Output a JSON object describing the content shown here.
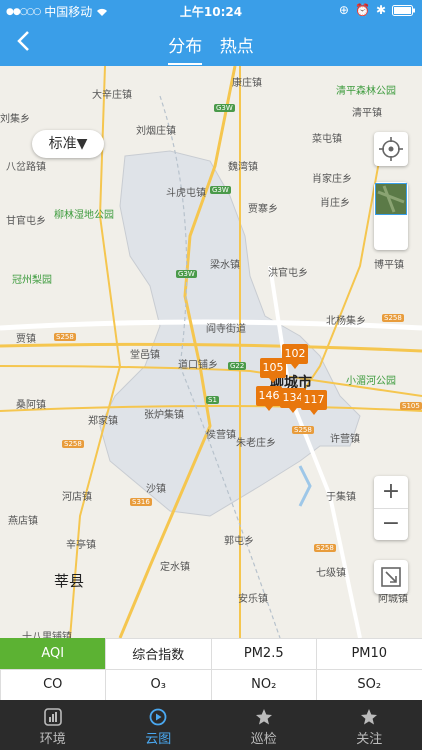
{
  "status_bar": {
    "carrier": "中国移动",
    "time": "上午10:24"
  },
  "header": {
    "tabs": [
      {
        "label": "分布",
        "active": true
      },
      {
        "label": "热点",
        "active": false
      }
    ]
  },
  "map": {
    "style_button_label": "标准▼",
    "places": [
      "大辛庄镇",
      "康庄镇",
      "清平森林公园",
      "刘集乡",
      "刘烟庄镇",
      "清平镇",
      "八岔路镇",
      "菜屯镇",
      "魏湾镇",
      "肖家庄乡",
      "斗虎屯镇",
      "贾寨乡",
      "肖庄乡",
      "甘官屯乡",
      "柳林湿地公园",
      "冠州梨园",
      "梁水镇",
      "洪官屯乡",
      "博平镇",
      "贾镇",
      "北杨集乡",
      "阎寺街道",
      "堂邑镇",
      "道口铺乡",
      "聊城市",
      "小湄河公园",
      "桑阿镇",
      "郑家镇",
      "张炉集镇",
      "侯营镇",
      "许营镇",
      "朱老庄乡",
      "河店镇",
      "沙镇",
      "于集镇",
      "燕店镇",
      "辛亭镇",
      "莘县",
      "郭屯乡",
      "定水镇",
      "七级镇",
      "安乐镇",
      "阿城镇",
      "十八里铺镇"
    ],
    "road_shields": [
      "G3W",
      "G3W",
      "G3W",
      "S258",
      "S258",
      "G22",
      "S1",
      "S258",
      "S105",
      "S316",
      "S258",
      "S258"
    ],
    "aqi_markers": [
      102,
      105,
      146,
      134,
      117
    ]
  },
  "metrics": {
    "row1": [
      "AQI",
      "综合指数",
      "PM2.5",
      "PM10"
    ],
    "row2": [
      "CO",
      "O₃",
      "NO₂",
      "SO₂"
    ],
    "active": "AQI"
  },
  "bottom_nav": [
    "环境",
    "云图",
    "巡检",
    "关注"
  ],
  "colors": {
    "brand": "#3a9ee8",
    "active_metric": "#5cb233",
    "marker": "#e8770d",
    "nav_active": "#4aa8f0"
  }
}
